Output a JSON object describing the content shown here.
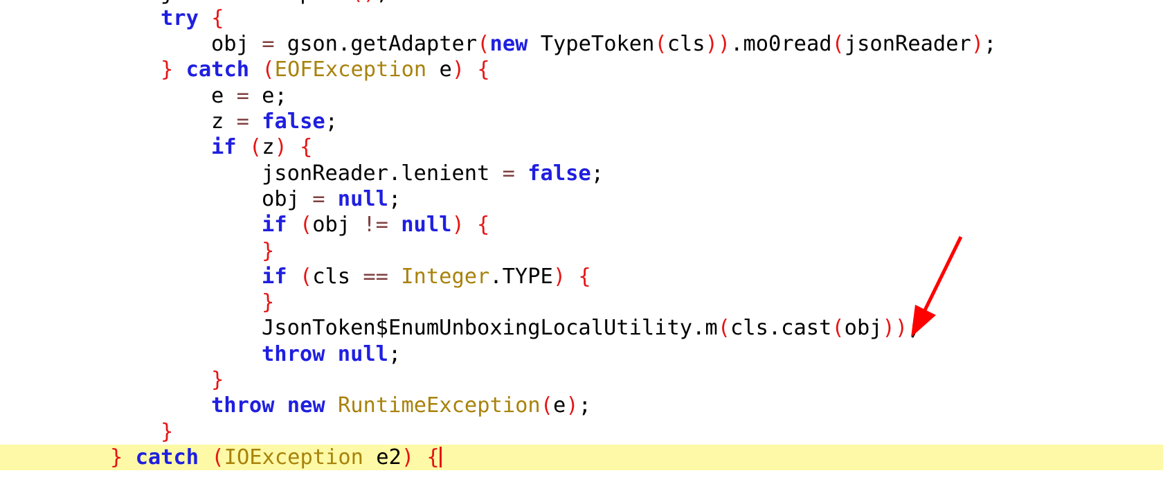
{
  "editor": {
    "current_line_color": "#fdf9a6",
    "colors": {
      "keyword": "#1f1fe0",
      "bracket": "#e61414",
      "operator": "#7f3f3f",
      "type": "#a8820c",
      "identifier": "#000000"
    },
    "lines": [
      {
        "indent": 0,
        "tokens": [
          [
            "id",
            "jsonReader.peek"
          ],
          [
            "br",
            "()"
          ],
          [
            "id",
            ";"
          ]
        ]
      },
      {
        "indent": 0,
        "tokens": [
          [
            "kw",
            "try"
          ],
          [
            "id",
            " "
          ],
          [
            "br",
            "{"
          ]
        ]
      },
      {
        "indent": 1,
        "tokens": [
          [
            "id",
            "obj "
          ],
          [
            "op",
            "="
          ],
          [
            "id",
            " gson.getAdapter"
          ],
          [
            "br",
            "("
          ],
          [
            "kw",
            "new"
          ],
          [
            "id",
            " TypeToken"
          ],
          [
            "br",
            "("
          ],
          [
            "id",
            "cls"
          ],
          [
            "br",
            "))"
          ],
          [
            "id",
            ".mo0read"
          ],
          [
            "br",
            "("
          ],
          [
            "id",
            "jsonReader"
          ],
          [
            "br",
            ")"
          ],
          [
            "id",
            ";"
          ]
        ]
      },
      {
        "indent": 0,
        "tokens": [
          [
            "br",
            "}"
          ],
          [
            "id",
            " "
          ],
          [
            "kw",
            "catch"
          ],
          [
            "id",
            " "
          ],
          [
            "br",
            "("
          ],
          [
            "type",
            "EOFException"
          ],
          [
            "id",
            " e"
          ],
          [
            "br",
            ")"
          ],
          [
            "id",
            " "
          ],
          [
            "br",
            "{"
          ]
        ]
      },
      {
        "indent": 1,
        "tokens": [
          [
            "id",
            "e "
          ],
          [
            "op",
            "="
          ],
          [
            "id",
            " e;"
          ]
        ]
      },
      {
        "indent": 1,
        "tokens": [
          [
            "id",
            "z "
          ],
          [
            "op",
            "="
          ],
          [
            "id",
            " "
          ],
          [
            "kw",
            "false"
          ],
          [
            "id",
            ";"
          ]
        ]
      },
      {
        "indent": 1,
        "tokens": [
          [
            "kw",
            "if"
          ],
          [
            "id",
            " "
          ],
          [
            "br",
            "("
          ],
          [
            "id",
            "z"
          ],
          [
            "br",
            ")"
          ],
          [
            "id",
            " "
          ],
          [
            "br",
            "{"
          ]
        ]
      },
      {
        "indent": 2,
        "tokens": [
          [
            "id",
            "jsonReader.lenient "
          ],
          [
            "op",
            "="
          ],
          [
            "id",
            " "
          ],
          [
            "kw",
            "false"
          ],
          [
            "id",
            ";"
          ]
        ]
      },
      {
        "indent": 2,
        "tokens": [
          [
            "id",
            "obj "
          ],
          [
            "op",
            "="
          ],
          [
            "id",
            " "
          ],
          [
            "kw",
            "null"
          ],
          [
            "id",
            ";"
          ]
        ]
      },
      {
        "indent": 2,
        "tokens": [
          [
            "kw",
            "if"
          ],
          [
            "id",
            " "
          ],
          [
            "br",
            "("
          ],
          [
            "id",
            "obj "
          ],
          [
            "op",
            "!="
          ],
          [
            "id",
            " "
          ],
          [
            "kw",
            "null"
          ],
          [
            "br",
            ")"
          ],
          [
            "id",
            " "
          ],
          [
            "br",
            "{"
          ]
        ]
      },
      {
        "indent": 2,
        "tokens": [
          [
            "br",
            "}"
          ]
        ]
      },
      {
        "indent": 2,
        "tokens": [
          [
            "kw",
            "if"
          ],
          [
            "id",
            " "
          ],
          [
            "br",
            "("
          ],
          [
            "id",
            "cls "
          ],
          [
            "op",
            "=="
          ],
          [
            "id",
            " "
          ],
          [
            "type",
            "Integer"
          ],
          [
            "id",
            ".TYPE"
          ],
          [
            "br",
            ")"
          ],
          [
            "id",
            " "
          ],
          [
            "br",
            "{"
          ]
        ]
      },
      {
        "indent": 2,
        "tokens": [
          [
            "br",
            "}"
          ]
        ]
      },
      {
        "indent": 2,
        "tokens": [
          [
            "id",
            "JsonToken$EnumUnboxingLocalUtility.m"
          ],
          [
            "br",
            "("
          ],
          [
            "id",
            "cls.cast"
          ],
          [
            "br",
            "("
          ],
          [
            "id",
            "obj"
          ],
          [
            "br",
            "))"
          ],
          [
            "id",
            ";"
          ]
        ]
      },
      {
        "indent": 2,
        "tokens": [
          [
            "kw",
            "throw"
          ],
          [
            "id",
            " "
          ],
          [
            "kw",
            "null"
          ],
          [
            "id",
            ";"
          ]
        ]
      },
      {
        "indent": 1,
        "tokens": [
          [
            "br",
            "}"
          ]
        ]
      },
      {
        "indent": 1,
        "tokens": [
          [
            "kw",
            "throw"
          ],
          [
            "id",
            " "
          ],
          [
            "kw",
            "new"
          ],
          [
            "id",
            " "
          ],
          [
            "type",
            "RuntimeException"
          ],
          [
            "br",
            "("
          ],
          [
            "id",
            "e"
          ],
          [
            "br",
            ")"
          ],
          [
            "id",
            ";"
          ]
        ]
      },
      {
        "indent": 0,
        "tokens": [
          [
            "br",
            "}"
          ]
        ]
      },
      {
        "indent": -1,
        "current": true,
        "cursor": true,
        "tokens": [
          [
            "br",
            "}"
          ],
          [
            "id",
            " "
          ],
          [
            "kw",
            "catch"
          ],
          [
            "id",
            " "
          ],
          [
            "br",
            "("
          ],
          [
            "type",
            "IOException"
          ],
          [
            "id",
            " e2"
          ],
          [
            "br",
            ")"
          ],
          [
            "id",
            " "
          ],
          [
            "br",
            "{"
          ]
        ]
      }
    ]
  },
  "annotation": {
    "type": "arrow",
    "color": "#ff0000",
    "points_to": "cls.cast(obj)"
  }
}
